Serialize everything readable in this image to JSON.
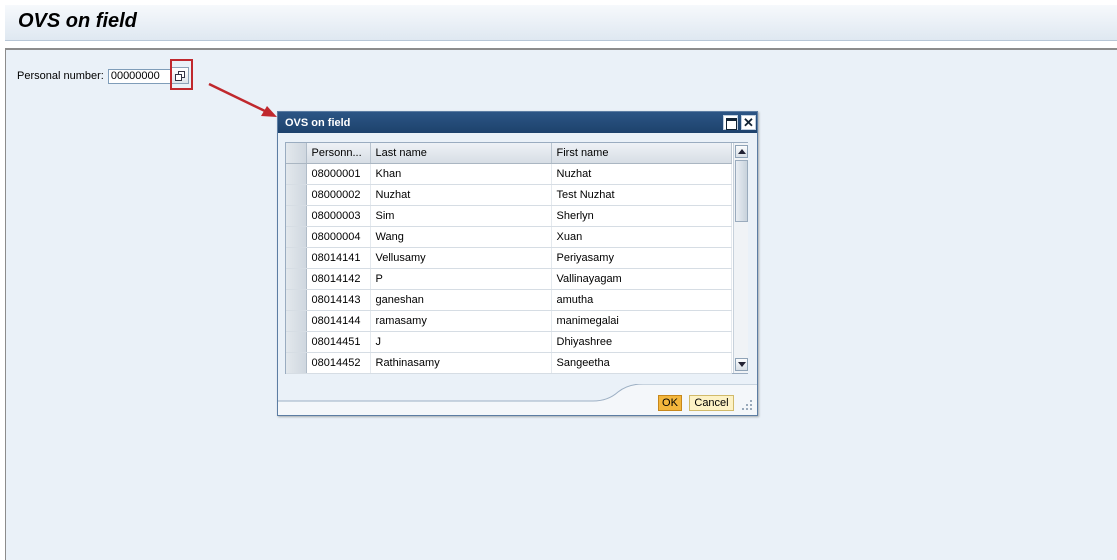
{
  "page": {
    "title": "OVS on field"
  },
  "field": {
    "label": "Personal number:",
    "value": "00000000"
  },
  "popup": {
    "title": "OVS on field",
    "columns": [
      "Personn...",
      "Last name",
      "First name"
    ],
    "rows": [
      [
        "08000001",
        "Khan",
        "Nuzhat"
      ],
      [
        "08000002",
        "Nuzhat",
        "Test Nuzhat"
      ],
      [
        "08000003",
        "Sim",
        "Sherlyn"
      ],
      [
        "08000004",
        "Wang",
        "Xuan"
      ],
      [
        "08014141",
        "Vellusamy",
        "Periyasamy"
      ],
      [
        "08014142",
        "P",
        "Vallinayagam"
      ],
      [
        "08014143",
        "ganeshan",
        "amutha"
      ],
      [
        "08014144",
        "ramasamy",
        "manimegalai"
      ],
      [
        "08014451",
        "J",
        "Dhiyashree"
      ],
      [
        "08014452",
        "Rathinasamy",
        "Sangeetha"
      ]
    ],
    "ok_label": "OK",
    "cancel_label": "Cancel",
    "close_glyph": "✕"
  },
  "colors": {
    "highlight": "#c0282d",
    "popup_title_bg": "#1d426c",
    "ok_button": "#f3b63c"
  }
}
